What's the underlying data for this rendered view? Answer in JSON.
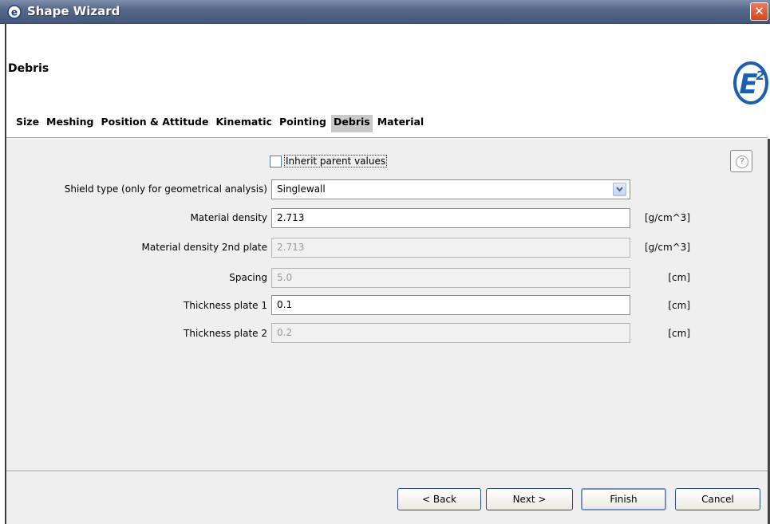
{
  "window": {
    "title": "Shape Wizard",
    "close_label": "✕"
  },
  "header": {
    "heading": "Debris"
  },
  "tabs": [
    {
      "label": "Size",
      "active": false
    },
    {
      "label": "Meshing",
      "active": false
    },
    {
      "label": "Position & Attitude",
      "active": false
    },
    {
      "label": "Kinematic",
      "active": false
    },
    {
      "label": "Pointing",
      "active": false
    },
    {
      "label": "Debris",
      "active": true
    },
    {
      "label": "Material",
      "active": false
    }
  ],
  "form": {
    "inherit_label": "Inherit parent values",
    "inherit_checked": false,
    "shield_type": {
      "label": "Shield type (only for geometrical analysis)",
      "value": "Singlewall"
    },
    "fields": [
      {
        "label": "Material density",
        "value": "2.713",
        "unit": "[g/cm^3]",
        "enabled": true
      },
      {
        "label": "Material density 2nd plate",
        "value": "2.713",
        "unit": "[g/cm^3]",
        "enabled": false
      },
      {
        "label": "Spacing",
        "value": "5.0",
        "unit": "[cm]",
        "enabled": false
      },
      {
        "label": "Thickness plate 1",
        "value": "0.1",
        "unit": "[cm]",
        "enabled": true
      },
      {
        "label": "Thickness plate 2",
        "value": "0.2",
        "unit": "[cm]",
        "enabled": false
      }
    ]
  },
  "help": {
    "icon": "question-icon",
    "glyph": "?"
  },
  "buttons": {
    "back": "< Back",
    "next": "Next >",
    "finish": "Finish",
    "cancel": "Cancel"
  },
  "colors": {
    "titlebar": "#57698a",
    "active_tab": "#c9c9c9",
    "close": "#d2461c"
  }
}
